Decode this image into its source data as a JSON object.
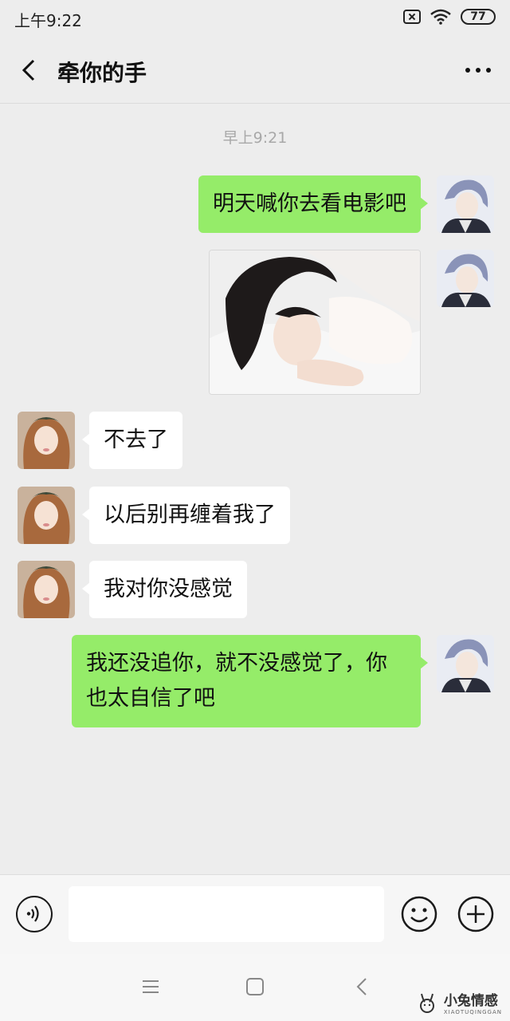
{
  "status_bar": {
    "time": "上午9:22",
    "battery": "77",
    "icons": [
      "sim-off-icon",
      "wifi-icon",
      "battery-icon"
    ]
  },
  "nav": {
    "back_icon": "chevron-left-icon",
    "title": "牵你的手",
    "more_icon": "more-dots-icon"
  },
  "chat": {
    "timestamp": "早上9:21",
    "messages": [
      {
        "side": "sent",
        "type": "text",
        "text": "明天喊你去看电影吧"
      },
      {
        "side": "sent",
        "type": "image"
      },
      {
        "side": "received",
        "type": "text",
        "text": "不去了"
      },
      {
        "side": "received",
        "type": "text",
        "text": "以后别再缠着我了"
      },
      {
        "side": "received",
        "type": "text",
        "text": "我对你没感觉"
      },
      {
        "side": "sent",
        "type": "text",
        "text": "我还没追你，就不没感觉了，你也太自信了吧"
      }
    ]
  },
  "input_bar": {
    "voice_icon": "voice-icon",
    "input_value": "",
    "emoji_icon": "emoji-icon",
    "plus_icon": "plus-icon"
  },
  "system_nav": {
    "icons": [
      "menu-icon",
      "home-icon",
      "back-icon"
    ]
  },
  "watermark": {
    "text": "小兔情感",
    "sub": "XIAOTUQINGGAN"
  },
  "colors": {
    "sent_bubble": "#95ec69",
    "received_bubble": "#ffffff",
    "background": "#ededed",
    "timestamp": "#a8a8a8"
  }
}
